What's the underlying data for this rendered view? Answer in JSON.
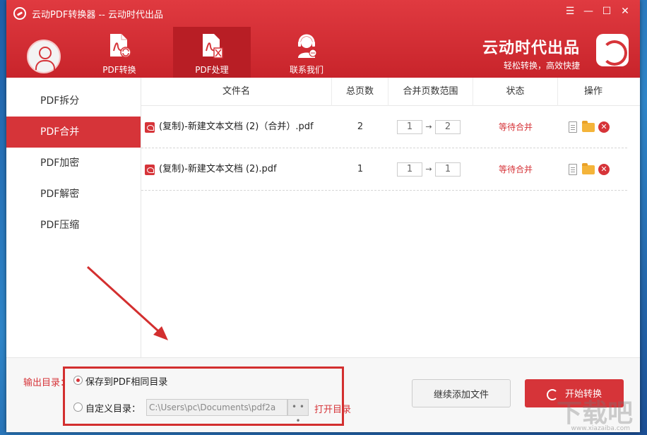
{
  "window": {
    "title": "云动PDF转换器 -- 云动时代出品",
    "controls": [
      "☰",
      "—",
      "☐",
      "✕"
    ]
  },
  "nav": {
    "tabs": [
      {
        "label": "PDF转换",
        "active": false
      },
      {
        "label": "PDF处理",
        "active": true
      },
      {
        "label": "联系我们",
        "active": false
      }
    ]
  },
  "brand": {
    "main": "云动时代出品",
    "sub": "轻松转换，高效快捷"
  },
  "sidebar": {
    "items": [
      {
        "label": "PDF拆分",
        "active": false
      },
      {
        "label": "PDF合并",
        "active": true
      },
      {
        "label": "PDF加密",
        "active": false
      },
      {
        "label": "PDF解密",
        "active": false
      },
      {
        "label": "PDF压缩",
        "active": false
      }
    ]
  },
  "table": {
    "columns": [
      "文件名",
      "总页数",
      "合并页数范围",
      "状态",
      "操作"
    ],
    "rows": [
      {
        "filename": "(复制)-新建文本文档 (2)（合并）.pdf",
        "pages": "2",
        "range_from": "1",
        "range_to": "2",
        "status": "等待合并"
      },
      {
        "filename": "(复制)-新建文本文档 (2).pdf",
        "pages": "1",
        "range_from": "1",
        "range_to": "1",
        "status": "等待合并"
      }
    ],
    "delete_glyph": "✕"
  },
  "footer": {
    "output_label": "输出目录：",
    "option_same": "保存到PDF相同目录",
    "option_custom": "自定义目录：",
    "custom_path": "C:\\Users\\pc\\Documents\\pdf2a",
    "browse_label": "• • •",
    "open_dir": "打开目录",
    "add_files": "继续添加文件",
    "start": "开始转换"
  },
  "watermark": {
    "main": "下载吧",
    "sub": "www.xiazaiba.com"
  },
  "colors": {
    "accent": "#d63439",
    "header": "#c8242b",
    "status": "#d63439"
  }
}
